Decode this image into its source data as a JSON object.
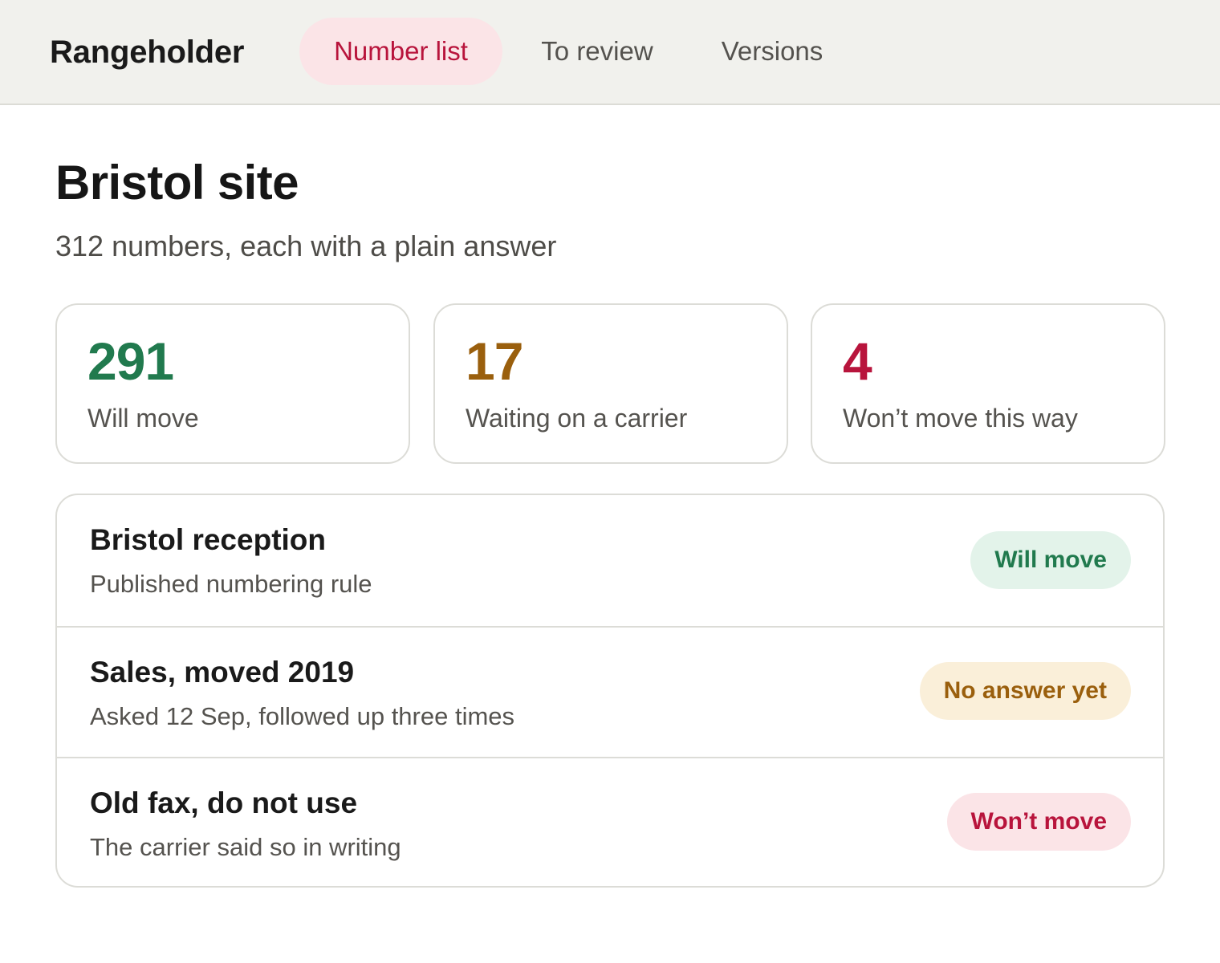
{
  "app": {
    "name": "Rangeholder"
  },
  "nav": {
    "tabs": [
      {
        "label": "Number list",
        "active": true
      },
      {
        "label": "To review",
        "active": false
      },
      {
        "label": "Versions",
        "active": false
      }
    ]
  },
  "page": {
    "title": "Bristol site",
    "subtitle": "312 numbers, each with a plain answer"
  },
  "summary": [
    {
      "value": "291",
      "label": "Will move",
      "color": "#217a4e"
    },
    {
      "value": "17",
      "label": "Waiting on a carrier",
      "color": "#9a5f0d"
    },
    {
      "value": "4",
      "label": "Won’t move this way",
      "color": "#b8143c"
    }
  ],
  "numbers": [
    {
      "title": "Bristol reception",
      "note": "Published numbering rule",
      "status": "Will move",
      "status_color": "#217a4e",
      "status_bg": "#e3f3ea"
    },
    {
      "title": "Sales, moved 2019",
      "note": "Asked 12 Sep, followed up three times",
      "status": "No answer yet",
      "status_color": "#9a5f0d",
      "status_bg": "#faefd9"
    },
    {
      "title": "Old fax, do not use",
      "note": "The carrier said so in writing",
      "status": "Won’t move",
      "status_color": "#b8143c",
      "status_bg": "#fbe4e7"
    }
  ]
}
